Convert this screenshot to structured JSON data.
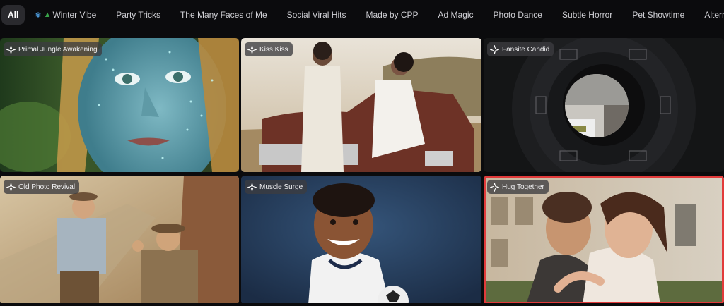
{
  "tabs": [
    {
      "label": "All",
      "active": true
    },
    {
      "label": "Winter Vibe",
      "icon": "snowflake-tree-icon"
    },
    {
      "label": "Party Tricks"
    },
    {
      "label": "The Many Faces of Me"
    },
    {
      "label": "Social Viral Hits"
    },
    {
      "label": "Made by CPP"
    },
    {
      "label": "Ad Magic"
    },
    {
      "label": "Photo Dance"
    },
    {
      "label": "Subtle Horror"
    },
    {
      "label": "Pet Showtime"
    },
    {
      "label": "Alternativ"
    }
  ],
  "cards": [
    {
      "title": "Primal Jungle Awakening",
      "icon": "sparkle-icon"
    },
    {
      "title": "Kiss Kiss",
      "icon": "sparkle-icon"
    },
    {
      "title": "Fansite Candid",
      "icon": "sparkle-icon"
    },
    {
      "title": "Old Photo Revival",
      "icon": "sparkle-icon"
    },
    {
      "title": "Muscle Surge",
      "icon": "sparkle-icon"
    },
    {
      "title": "Hug Together",
      "icon": "sparkle-icon",
      "selected": true
    }
  ],
  "colors": {
    "background": "#0b0b0d",
    "active_tab": "#2a2a2e",
    "selection": "#e23b3b"
  }
}
